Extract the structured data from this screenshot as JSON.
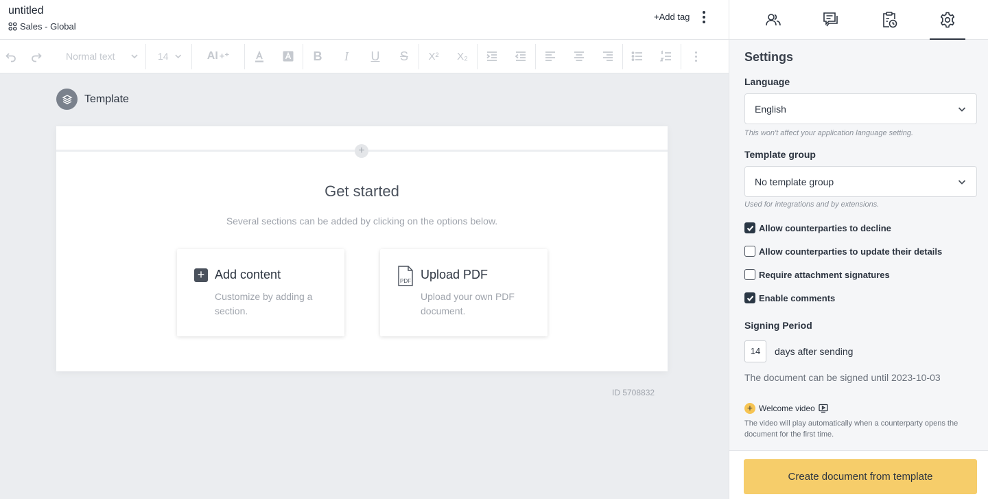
{
  "header": {
    "doc_title": "untitled",
    "workspace": "Sales - Global",
    "add_tag": "+Add tag"
  },
  "toolbar": {
    "text_style": "Normal text",
    "font_size": "14",
    "ai_label": "AI"
  },
  "canvas": {
    "template_label": "Template",
    "get_started": "Get started",
    "subtitle": "Several sections can be added by clicking on the options below.",
    "cards": [
      {
        "title": "Add content",
        "description": "Customize by adding a section."
      },
      {
        "title": "Upload PDF",
        "description": "Upload your own PDF document."
      }
    ],
    "doc_id": "ID 5708832"
  },
  "settings": {
    "heading": "Settings",
    "language_label": "Language",
    "language_value": "English",
    "language_hint": "This won't affect your application language setting.",
    "group_label": "Template group",
    "group_value": "No template group",
    "group_hint": "Used for integrations and by extensions.",
    "checkboxes": [
      {
        "label": "Allow counterparties to decline",
        "checked": true
      },
      {
        "label": "Allow counterparties to update their details",
        "checked": false
      },
      {
        "label": "Require attachment signatures",
        "checked": false
      },
      {
        "label": "Enable comments",
        "checked": true
      }
    ],
    "signing_period_label": "Signing Period",
    "signing_days": "14",
    "days_suffix": "days after sending",
    "signed_until": "The document can be signed until 2023-10-03",
    "welcome_video_label": "Welcome video",
    "welcome_video_desc": "The video will play automatically when a counterparty opens the document for the first time.",
    "create_button": "Create document from template"
  },
  "colors": {
    "accent_yellow": "#f6cd6a",
    "checkbox_on": "#2a3745",
    "text_dark": "#2c3440"
  }
}
